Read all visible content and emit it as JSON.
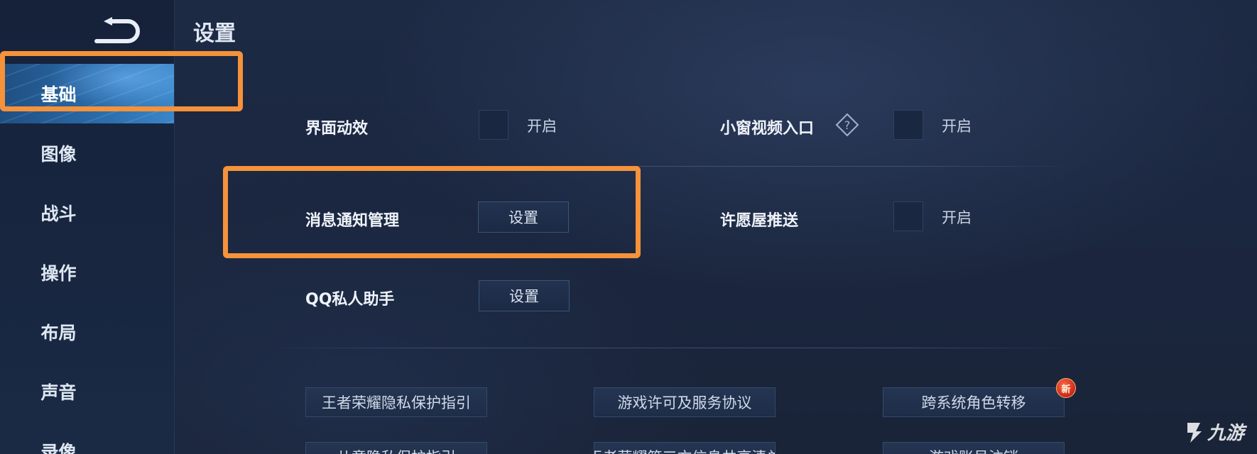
{
  "header": {
    "title": "设置"
  },
  "sidebar": {
    "items": [
      {
        "label": "基础",
        "active": true
      },
      {
        "label": "图像",
        "active": false
      },
      {
        "label": "战斗",
        "active": false
      },
      {
        "label": "操作",
        "active": false
      },
      {
        "label": "布局",
        "active": false
      },
      {
        "label": "声音",
        "active": false
      },
      {
        "label": "录像",
        "active": false
      }
    ]
  },
  "settings": {
    "ui_effects": {
      "label": "界面动效",
      "option": "开启",
      "checked": false
    },
    "mini_video": {
      "label": "小窗视频入口",
      "option": "开启",
      "checked": false,
      "icon": "help-icon"
    },
    "notification_mgmt": {
      "label": "消息通知管理",
      "button": "设置"
    },
    "wish_push": {
      "label": "许愿屋推送",
      "option": "开启",
      "checked": false
    },
    "qq_assistant": {
      "label": "QQ私人助手",
      "button": "设置"
    }
  },
  "links": [
    "王者荣耀隐私保护指引",
    "游戏许可及服务协议",
    "跨系统角色转移",
    "儿童隐私保护指引",
    "王者荣耀第三方信息共享清单",
    "游戏账号注销"
  ],
  "badge": {
    "text": "新"
  },
  "watermark": {
    "text": "九游"
  },
  "colors": {
    "highlight": "#f5923a",
    "active_tab": "#2a6aa8",
    "background": "#1b2740",
    "badge": "#c9261a"
  }
}
